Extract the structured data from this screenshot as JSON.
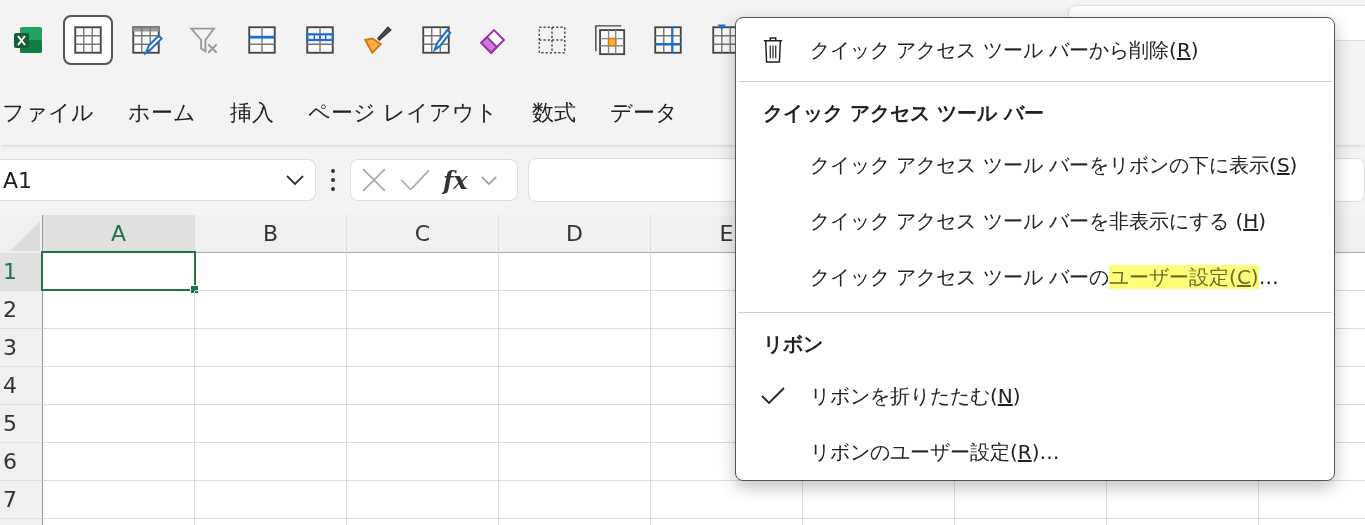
{
  "quick_access_toolbar": {
    "buttons": [
      {
        "selected": true
      },
      {
        "selected": false
      },
      {
        "selected": false
      },
      {
        "selected": false
      },
      {
        "selected": false
      },
      {
        "selected": false
      },
      {
        "selected": false
      },
      {
        "selected": false
      },
      {
        "selected": false
      },
      {
        "selected": false
      },
      {
        "selected": false
      },
      {
        "selected": false
      }
    ]
  },
  "ribbon_tabs": [
    {
      "label": "ファイル"
    },
    {
      "label": "ホーム"
    },
    {
      "label": "挿入"
    },
    {
      "label": "ページ レイアウト"
    },
    {
      "label": "数式"
    },
    {
      "label": "データ"
    }
  ],
  "formula_bar": {
    "name_box": "A1",
    "function_button": "fx"
  },
  "sheet": {
    "columns": [
      {
        "label": "A",
        "selected": true
      },
      {
        "label": "B",
        "selected": false
      },
      {
        "label": "C",
        "selected": false
      },
      {
        "label": "D",
        "selected": false
      },
      {
        "label": "E",
        "selected": false
      }
    ],
    "rows": [
      {
        "label": "1",
        "selected": true
      },
      {
        "label": "2",
        "selected": false
      },
      {
        "label": "3",
        "selected": false
      },
      {
        "label": "4",
        "selected": false
      },
      {
        "label": "5",
        "selected": false
      },
      {
        "label": "6",
        "selected": false
      },
      {
        "label": "7",
        "selected": false
      }
    ]
  },
  "context_menu": {
    "sections": [
      {
        "items": [
          {
            "kind": "command",
            "parts": [
              {
                "text": "クイック アクセス ツール バーから削除(",
                "underlined": false,
                "highlighted": false
              },
              {
                "text": "R",
                "underlined": true,
                "highlighted": false
              },
              {
                "text": ")",
                "underlined": false,
                "highlighted": false
              }
            ]
          }
        ]
      },
      {
        "heading": "クイック アクセス ツール バー",
        "items": [
          {
            "kind": "option",
            "checked": false,
            "parts": [
              {
                "text": "クイック アクセス ツール バーをリボンの下に表示(",
                "underlined": false,
                "highlighted": false
              },
              {
                "text": "S",
                "underlined": true,
                "highlighted": false
              },
              {
                "text": ")",
                "underlined": false,
                "highlighted": false
              }
            ]
          },
          {
            "kind": "option",
            "checked": false,
            "parts": [
              {
                "text": "クイック アクセス ツール バーを非表示にする (",
                "underlined": false,
                "highlighted": false
              },
              {
                "text": "H",
                "underlined": true,
                "highlighted": false
              },
              {
                "text": ")",
                "underlined": false,
                "highlighted": false
              }
            ]
          },
          {
            "kind": "option",
            "checked": false,
            "parts": [
              {
                "text": "クイック アクセス ツール バーの",
                "underlined": false,
                "highlighted": false
              },
              {
                "text": "ユーザー設定(",
                "underlined": false,
                "highlighted": true
              },
              {
                "text": "C",
                "underlined": true,
                "highlighted": true
              },
              {
                "text": ")",
                "underlined": false,
                "highlighted": true
              },
              {
                "text": "…",
                "underlined": false,
                "highlighted": false
              }
            ]
          }
        ]
      },
      {
        "heading": "リボン",
        "items": [
          {
            "kind": "option",
            "checked": true,
            "parts": [
              {
                "text": "リボンを折りたたむ(",
                "underlined": false,
                "highlighted": false
              },
              {
                "text": "N",
                "underlined": true,
                "highlighted": false
              },
              {
                "text": ")",
                "underlined": false,
                "highlighted": false
              }
            ]
          },
          {
            "kind": "option",
            "checked": false,
            "parts": [
              {
                "text": "リボンのユーザー設定(",
                "underlined": false,
                "highlighted": false
              },
              {
                "text": "R",
                "underlined": true,
                "highlighted": false
              },
              {
                "text": ")…",
                "underlined": false,
                "highlighted": false
              }
            ]
          }
        ]
      }
    ]
  }
}
